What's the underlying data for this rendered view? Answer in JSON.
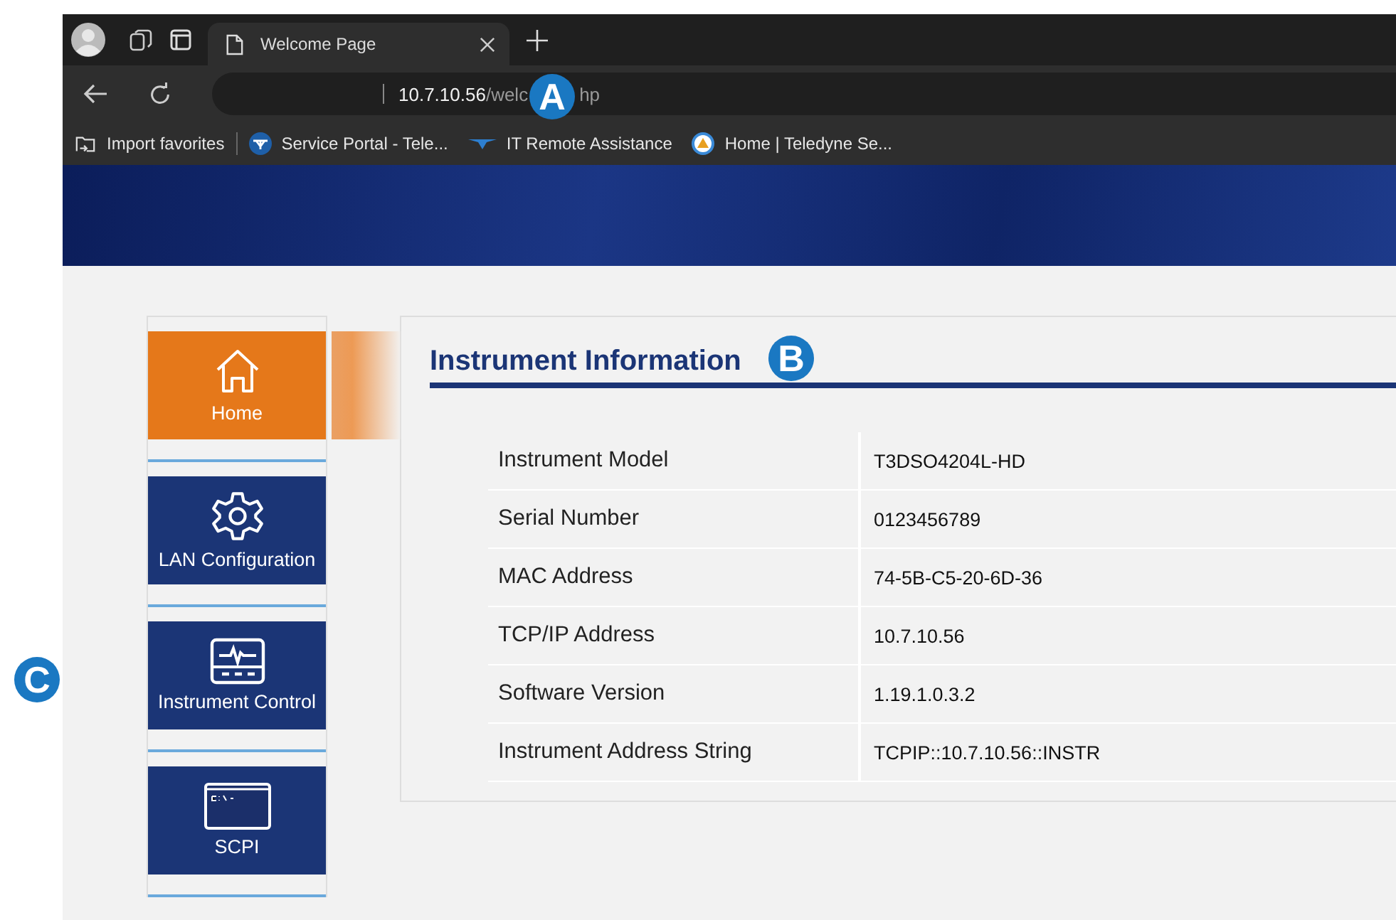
{
  "browser": {
    "tab": {
      "title": "Welcome Page"
    },
    "address": {
      "host": "10.7.10.56",
      "path_before": "/welc",
      "path_after": "hp"
    },
    "bookmarks": [
      {
        "kind": "import",
        "label": "Import favorites"
      },
      {
        "kind": "portal",
        "label": "Service Portal - Tele..."
      },
      {
        "kind": "remote",
        "label": "IT Remote Assistance"
      },
      {
        "kind": "home",
        "label": "Home | Teledyne Se..."
      }
    ]
  },
  "sidebar": {
    "items": [
      {
        "kind": "home",
        "label": "Home",
        "selected": true
      },
      {
        "kind": "gear",
        "label": "LAN Configuration",
        "selected": false
      },
      {
        "kind": "monitor",
        "label": "Instrument Control",
        "selected": false
      },
      {
        "kind": "terminal",
        "label": "SCPI",
        "selected": false
      }
    ]
  },
  "panel": {
    "title": "Instrument Information",
    "rows": [
      {
        "label": "Instrument Model",
        "value": "T3DSO4204L-HD"
      },
      {
        "label": "Serial Number",
        "value": "0123456789"
      },
      {
        "label": "MAC Address",
        "value": "74-5B-C5-20-6D-36"
      },
      {
        "label": "TCP/IP Address",
        "value": "10.7.10.56"
      },
      {
        "label": "Software Version",
        "value": "1.19.1.0.3.2"
      },
      {
        "label": "Instrument Address String",
        "value": "TCPIP::10.7.10.56::INSTR"
      }
    ]
  },
  "callouts": [
    {
      "label": "A"
    },
    {
      "label": "B"
    },
    {
      "label": "C"
    }
  ]
}
